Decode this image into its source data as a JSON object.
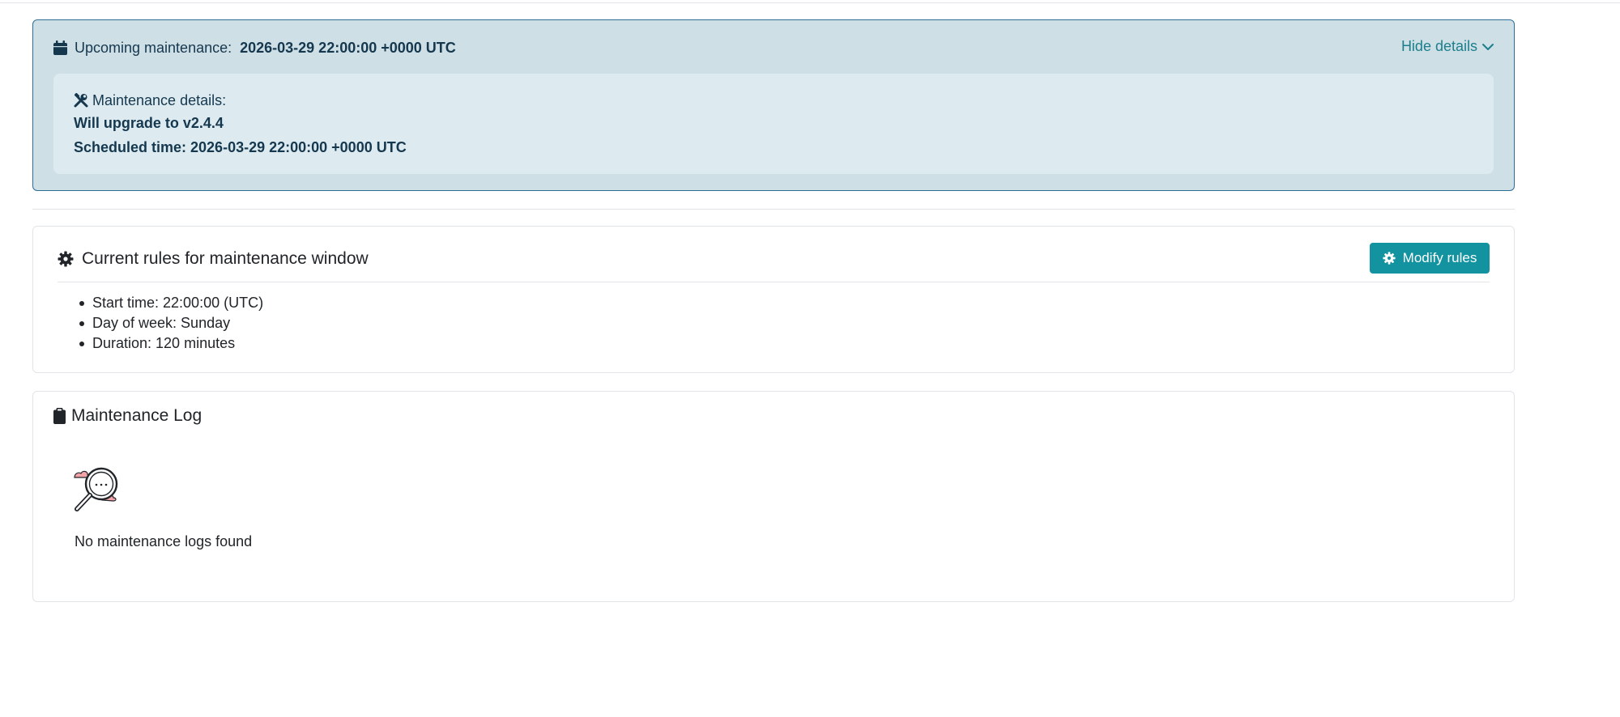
{
  "maintenance_alert": {
    "label": "Upcoming maintenance:",
    "datetime": "2026-03-29 22:00:00 +0000 UTC",
    "toggle_label": "Hide details",
    "details": {
      "heading": "Maintenance details:",
      "description": "Will upgrade to v2.4.4",
      "scheduled_time": "Scheduled time: 2026-03-29 22:00:00 +0000 UTC"
    }
  },
  "rules_card": {
    "title": "Current rules for maintenance window",
    "modify_button": "Modify rules",
    "rules": [
      "Start time: 22:00:00 (UTC)",
      "Day of week: Sunday",
      "Duration: 120 minutes"
    ]
  },
  "log_card": {
    "title": "Maintenance Log",
    "empty_message": "No maintenance logs found"
  },
  "icons": {
    "calendar": "calendar-icon",
    "chevron": "chevron-down-icon",
    "tools": "tools-icon",
    "gear": "gear-icon",
    "clipboard": "clipboard-icon",
    "empty_state": "search-empty-illustration"
  },
  "colors": {
    "alert_background": "#cfdfe6",
    "alert_border": "#2f6f95",
    "details_background": "#ddebf0",
    "link_accent": "#1b7f8c",
    "button_primary": "#1392a0",
    "illustration_accent": "#f4a3a8"
  }
}
